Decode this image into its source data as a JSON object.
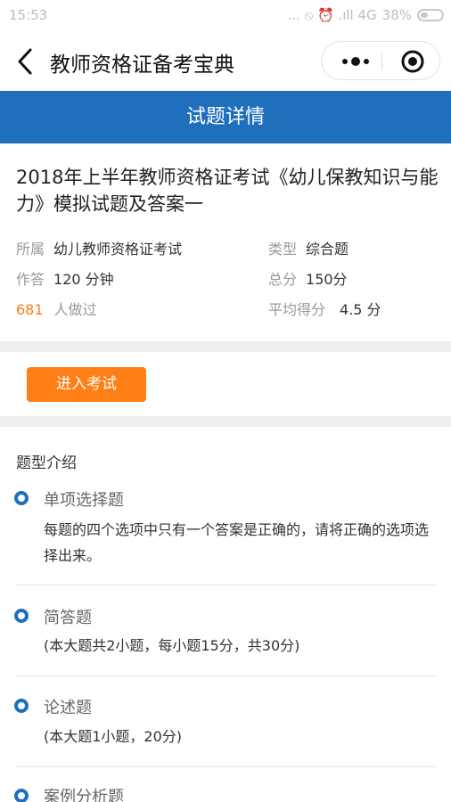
{
  "statusbar": {
    "time": "15:53",
    "icons_text": "... ⦸ ⏰ .ıll 4G",
    "battery": "38%"
  },
  "navbar": {
    "title": "教师资格证备考宝典"
  },
  "header": {
    "title": "试题详情"
  },
  "exam": {
    "title": "2018年上半年教师资格证考试《幼儿保教知识与能力》模拟试题及答案一",
    "belong_label": "所属",
    "belong_value": "幼儿教师资格证考试",
    "type_label": "类型",
    "type_value": "综合题",
    "time_label": "作答",
    "time_value": "120 分钟",
    "total_label": "总分",
    "total_value": "150分",
    "done_count": "681",
    "done_label": "人做过",
    "avg_label": "平均得分",
    "avg_value": "4.5 分"
  },
  "actions": {
    "enter_label": "进入考试"
  },
  "question_types": {
    "heading": "题型介绍",
    "items": [
      {
        "name": "单项选择题",
        "desc": "每题的四个选项中只有一个答案是正确的，请将正确的选项选择出来。"
      },
      {
        "name": "简答题",
        "desc": "(本大题共2小题，每小题15分，共30分)"
      },
      {
        "name": "论述题",
        "desc": "(本大题1小题，20分)"
      },
      {
        "name": "案例分析题",
        "desc": ""
      }
    ]
  },
  "colors": {
    "brand_blue": "#1f6fbd",
    "accent_orange": "#ff7f16",
    "count_orange": "#ff7a1a"
  }
}
